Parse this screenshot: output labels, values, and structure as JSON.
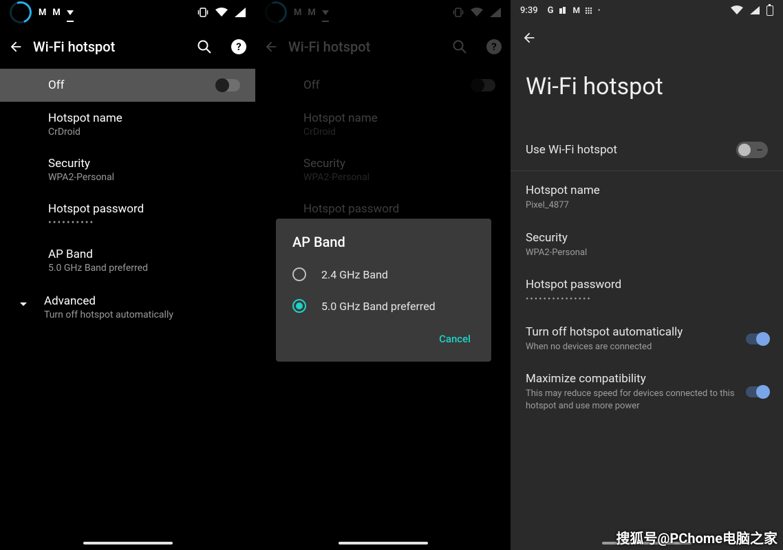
{
  "watermark": "搜狐号@PChome电脑之家",
  "phone1": {
    "header_title": "Wi-Fi hotspot",
    "toggle_label": "Off",
    "hotspot_name_label": "Hotspot name",
    "hotspot_name_value": "CrDroid",
    "security_label": "Security",
    "security_value": "WPA2-Personal",
    "password_label": "Hotspot password",
    "password_value": "••••••••••",
    "apband_label": "AP Band",
    "apband_value": "5.0 GHz Band preferred",
    "advanced_label": "Advanced",
    "advanced_sub": "Turn off hotspot automatically"
  },
  "phone2": {
    "header_title": "Wi-Fi hotspot",
    "toggle_label": "Off",
    "hotspot_name_label": "Hotspot name",
    "hotspot_name_value": "CrDroid",
    "security_label": "Security",
    "security_value": "WPA2-Personal",
    "password_label_partial": "Hotspot password",
    "dialog": {
      "title": "AP Band",
      "options": [
        {
          "label": "2.4 GHz Band",
          "selected": false
        },
        {
          "label": "5.0 GHz Band preferred",
          "selected": true
        }
      ],
      "cancel": "Cancel"
    }
  },
  "phone3": {
    "clock": "9:39",
    "big_title": "Wi-Fi hotspot",
    "use_hotspot_label": "Use Wi-Fi hotspot",
    "hotspot_name_label": "Hotspot name",
    "hotspot_name_value": "Pixel_4877",
    "security_label": "Security",
    "security_value": "WPA2-Personal",
    "password_label": "Hotspot password",
    "password_value": "•••••••••••••••",
    "auto_off_label": "Turn off hotspot automatically",
    "auto_off_sub": "When no devices are connected",
    "compat_label": "Maximize compatibility",
    "compat_sub": "This may reduce speed for devices connected to this hotspot and use more power"
  }
}
